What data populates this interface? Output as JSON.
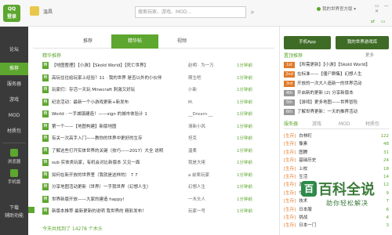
{
  "app": {
    "logo_line1": "QQ",
    "logo_line2": "登录",
    "username": "温昌",
    "search_placeholder": "搜索玩家、游戏、MOD...",
    "status_text": "我的世界官方版 ▾",
    "window_controls": "▭ — ✕",
    "tool_icons": "⇄ ▭"
  },
  "sidebar": {
    "items": [
      {
        "label": "论坛",
        "icon": "forum-icon",
        "active": false
      },
      {
        "label": "推荐",
        "icon": "recommend-icon",
        "active": true
      },
      {
        "label": "服务器",
        "icon": "server-icon",
        "active": false
      },
      {
        "label": "游戏",
        "icon": "game-icon",
        "active": false
      },
      {
        "label": "MOD",
        "icon": "mod-icon",
        "active": false
      },
      {
        "label": "材质包",
        "icon": "texture-icon",
        "active": false
      }
    ],
    "cards": [
      {
        "label": "浏览器",
        "icon": "browser-icon"
      },
      {
        "label": "手机版",
        "icon": "phone-icon"
      }
    ],
    "bottom": [
      {
        "label": "下载"
      },
      {
        "label": "辅助功能"
      }
    ]
  },
  "main": {
    "tabs": [
      {
        "label": "推荐",
        "active": false
      },
      {
        "label": "精华帖",
        "active": true
      },
      {
        "label": "视频",
        "active": false
      }
    ],
    "section_title": "精华推荐",
    "rows": [
      {
        "tag": "精",
        "title": "【地图整理】【小游】【Skold World】【死亡世界】",
        "author": "赵明 · 为一万",
        "count": "1分钟前"
      },
      {
        "tag": "精",
        "title": "高玩往往给玩家上经验？11 · 我的世界 是否以外的小伙伴",
        "author": "萌生吧",
        "count": "1分钟前"
      },
      {
        "tag": "精",
        "title": "玩家们：存活一天玩 Minecraft 刺激又好玩",
        "author": "小新",
        "count": "1分钟前"
      },
      {
        "tag": "精",
        "title": "纪念活动：最新一个小游戏更新+新发布",
        "author": "M.",
        "count": "1分钟前"
      },
      {
        "tag": "精",
        "title": "World · 一手城镇建造！——sign 的城市体验计 1",
        "author": "__Dream·__",
        "count": "1分钟前"
      },
      {
        "tag": "精",
        "title": "第一个——【地图构建】新版地图",
        "author": "清新小风",
        "count": "1分钟前"
      },
      {
        "tag": "精",
        "title": "有关一次高手入门——教你的世界中更好的生存",
        "author": "坦克",
        "count": "1分钟前"
      },
      {
        "tag": "精",
        "title": "了解这些打开实体世界的关键（技巧——2017）大全 说明",
        "author": "温柔",
        "count": "1分钟前"
      },
      {
        "tag": "精",
        "title": "sub 实体类玩家，有机会对比新版本 又见一面",
        "author": "我是大佬",
        "count": "1分钟前"
      },
      {
        "tag": "精",
        "title": "如何在新开放的世界里（我就是这样的） 7 7",
        "author": "a 前辈玩家",
        "count": "1分钟前"
      },
      {
        "tag": "精",
        "title": "分享地图活动更新（世界）一手我世界（幻想人生）",
        "author": "幻想人生",
        "count": "1分钟前"
      },
      {
        "tag": "精",
        "title": "世界新版开放——大家的建造 happy!",
        "author": "一木头人",
        "count": "1分钟前"
      },
      {
        "tag": "精",
        "title": "新版本推荐·最新更新的说明 我世界的 精彩发布！",
        "author": "玩家一号",
        "count": "1分钟前"
      }
    ],
    "footer": "今天共找到了 14278 个木头"
  },
  "right": {
    "buttons": [
      {
        "label": "手机App",
        "icon": "phone-app-icon"
      },
      {
        "label": "我的世界游戏库",
        "icon": "library-icon"
      }
    ],
    "news_title": "置顶推荐",
    "news_more": "更多",
    "news": [
      {
        "num": "1st",
        "title": "【所需更新】【小游】【Skold World】",
        "grey": false
      },
      {
        "num": "2nd",
        "title": "在标准——【僵尸群集】幻想人生",
        "grey": false
      },
      {
        "num": "3rd",
        "title": "开放的一次大人造新一的世界活动",
        "grey": false
      },
      {
        "num": "4th",
        "title": "开启新的更新 (2) 分享新版本",
        "grey": true
      },
      {
        "num": "5th",
        "title": "【游戏】更多地图——世界冒险",
        "grey": true
      },
      {
        "num": "6th",
        "title": "了解世界更新：一天的推荐活动",
        "grey": true
      }
    ],
    "subtabs": [
      {
        "label": "服务器",
        "active": true
      },
      {
        "label": "游戏",
        "active": false
      },
      {
        "label": "MOD",
        "active": false
      },
      {
        "label": "材质包",
        "active": false
      }
    ],
    "servers": [
      {
        "tag": "[生存]",
        "name": "白林町",
        "count": "122"
      },
      {
        "tag": "[生存]",
        "name": "像素",
        "count": "48"
      },
      {
        "tag": "[生存]",
        "name": "图腾",
        "count": "31"
      },
      {
        "tag": "[生存]",
        "name": "基础历史",
        "count": "24"
      },
      {
        "tag": "[生存]",
        "name": "上校",
        "count": "18"
      },
      {
        "tag": "[生存]",
        "name": "生活",
        "count": "14"
      },
      {
        "tag": "[生存]",
        "name": "游戏",
        "count": "12"
      },
      {
        "tag": "[生存]",
        "name": "牛世界",
        "count": "9"
      },
      {
        "tag": "[生存]",
        "name": "技术",
        "count": "7"
      },
      {
        "tag": "[生存]",
        "name": "日本服",
        "count": "6"
      },
      {
        "tag": "[生存]",
        "name": "挑战",
        "count": "4"
      },
      {
        "tag": "[生存]",
        "name": "日本一门",
        "count": "3"
      }
    ]
  },
  "watermark": {
    "logo": "百",
    "title": "百科全说",
    "subtitle": "助你轻松解决"
  },
  "colors": {
    "accent": "#5da62f",
    "sidebar": "#3a3a3a",
    "orange": "#e07a2a"
  }
}
